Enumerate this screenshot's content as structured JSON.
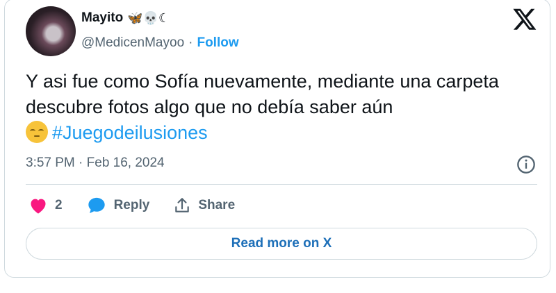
{
  "author": {
    "name": "Mayito",
    "name_emojis": "🦋💀☾",
    "handle": "@MedicenMayoo",
    "separator": "·",
    "follow_label": "Follow"
  },
  "tweet": {
    "text": "Y asi fue como Sofía nuevamente, mediante una carpeta descubre fotos  algo que no debía saber aún",
    "hashtag": "#Juegodeilusiones",
    "timestamp": "3:57 PM · Feb 16, 2024"
  },
  "actions": {
    "like_count": "2",
    "reply_label": "Reply",
    "share_label": "Share"
  },
  "read_more_label": "Read more on X",
  "colors": {
    "accent": "#1d9bf0",
    "heart": "#f91880",
    "muted": "#536471",
    "border": "#cfd9de"
  }
}
